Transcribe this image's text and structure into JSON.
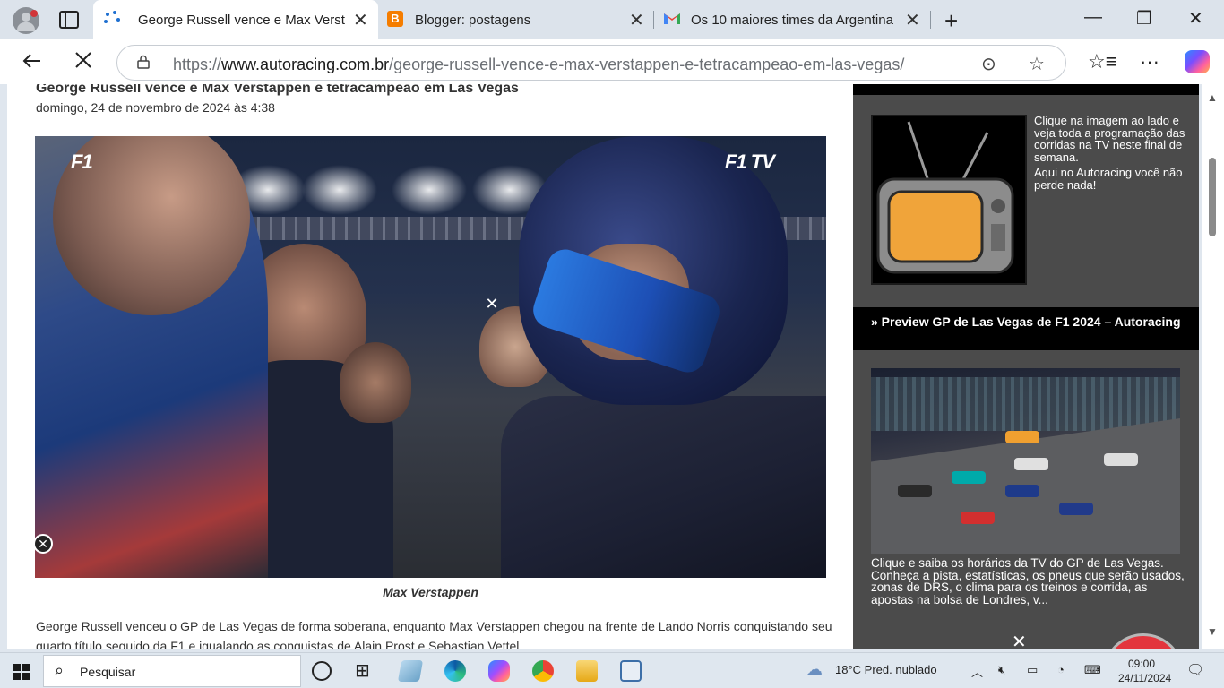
{
  "browser": {
    "tabs": [
      {
        "title": "George Russell vence e Max Verst",
        "active": true
      },
      {
        "title": "Blogger: postagens",
        "active": false
      },
      {
        "title": "Os 10 maiores times da Argentina",
        "active": false
      }
    ],
    "url_prefix": "https://",
    "url_domain": "www.autoracing.com.br",
    "url_path": "/george-russell-vence-e-max-verstappen-e-tetracampeao-em-las-vegas/",
    "icons": {
      "back": "back-arrow-icon",
      "stop": "stop-loading-icon",
      "lock": "lock-icon",
      "reader": "more-page-actions-icon",
      "favorite": "favorite-star-icon",
      "favorites_list": "favorites-icon",
      "menu": "more-options-icon",
      "copilot": "copilot-icon"
    }
  },
  "article": {
    "title": "George Russell vence e Max Verstappen e tetracampeão em Las Vegas",
    "date": "domingo, 24 de novembro de 2024 às 4:38",
    "photo_logo_left": "F1",
    "photo_logo_right": "F1 TV",
    "caption": "Max Verstappen",
    "body": "George Russell venceu o GP de Las Vegas de forma soberana, enquanto Max Verstappen chegou na frente de Lando Norris conquistando seu quarto título seguido da F1 e igualando as conquistas de Alain Prost e Sebastian Vettel"
  },
  "sidebar": {
    "tv_text_1": "Clique na imagem ao lado e veja toda a programação das corridas na TV neste final de semana.",
    "tv_text_2": "Aqui no Autoracing você não perde nada!",
    "preview_heading": "» Preview GP de Las Vegas de F1 2024 – Autoracing",
    "preview_text": "Clique e saiba os horários da TV do GP de Las Vegas. Conheça a pista, estatísticas, os pneus que serão usados, zonas de DRS, o clima para os treinos e corrida, as apostas na bolsa de Londres, v..."
  },
  "taskbar": {
    "search_placeholder": "Pesquisar",
    "weather": "18°C  Pred. nublado",
    "time": "09:00",
    "date": "24/11/2024"
  },
  "colors": {
    "accent_red": "#e3353d",
    "sidebar_bg": "#4b4b4b",
    "tab_strip": "#dce3eb"
  }
}
